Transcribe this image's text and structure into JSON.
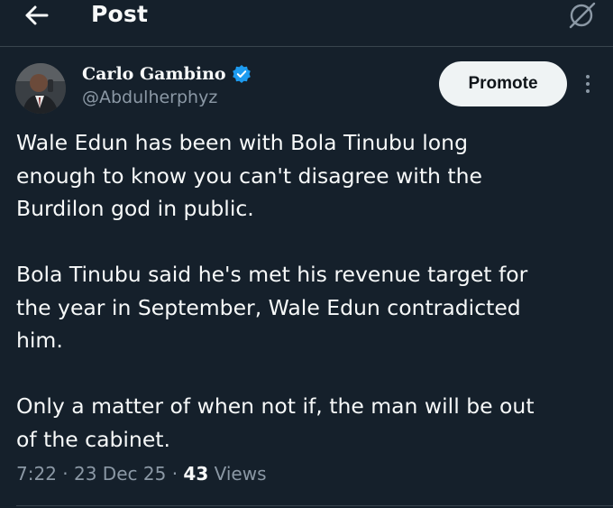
{
  "header": {
    "title": "Post",
    "back_icon": "arrow-left-icon",
    "grok_icon": "grok-icon"
  },
  "author": {
    "display_name": "Carlo Gambino",
    "handle": "@Abdulherphyz",
    "verified": true,
    "verified_color": "#1d9bf0"
  },
  "actions": {
    "promote_label": "Promote",
    "more_icon": "more-vertical-icon"
  },
  "tweet": {
    "paragraphs": [
      "Wale Edun has been with Bola Tinubu long\nenough to know you can't disagree with the\nBurdilon god in public.",
      "Bola Tinubu said he's met his revenue target for\nthe year in September, Wale Edun contradicted\nhim.",
      "Only a matter of when not if, the man will be out\nof the cabinet."
    ]
  },
  "meta": {
    "time": "7:22",
    "separator": "·",
    "date": "23 Dec 25",
    "views_count": "43",
    "views_label": "Views"
  },
  "colors": {
    "background": "#15202b",
    "text_primary": "#f7f9f9",
    "text_secondary": "#8b98a5",
    "divider": "#38444d",
    "button_bg": "#eff3f4"
  }
}
